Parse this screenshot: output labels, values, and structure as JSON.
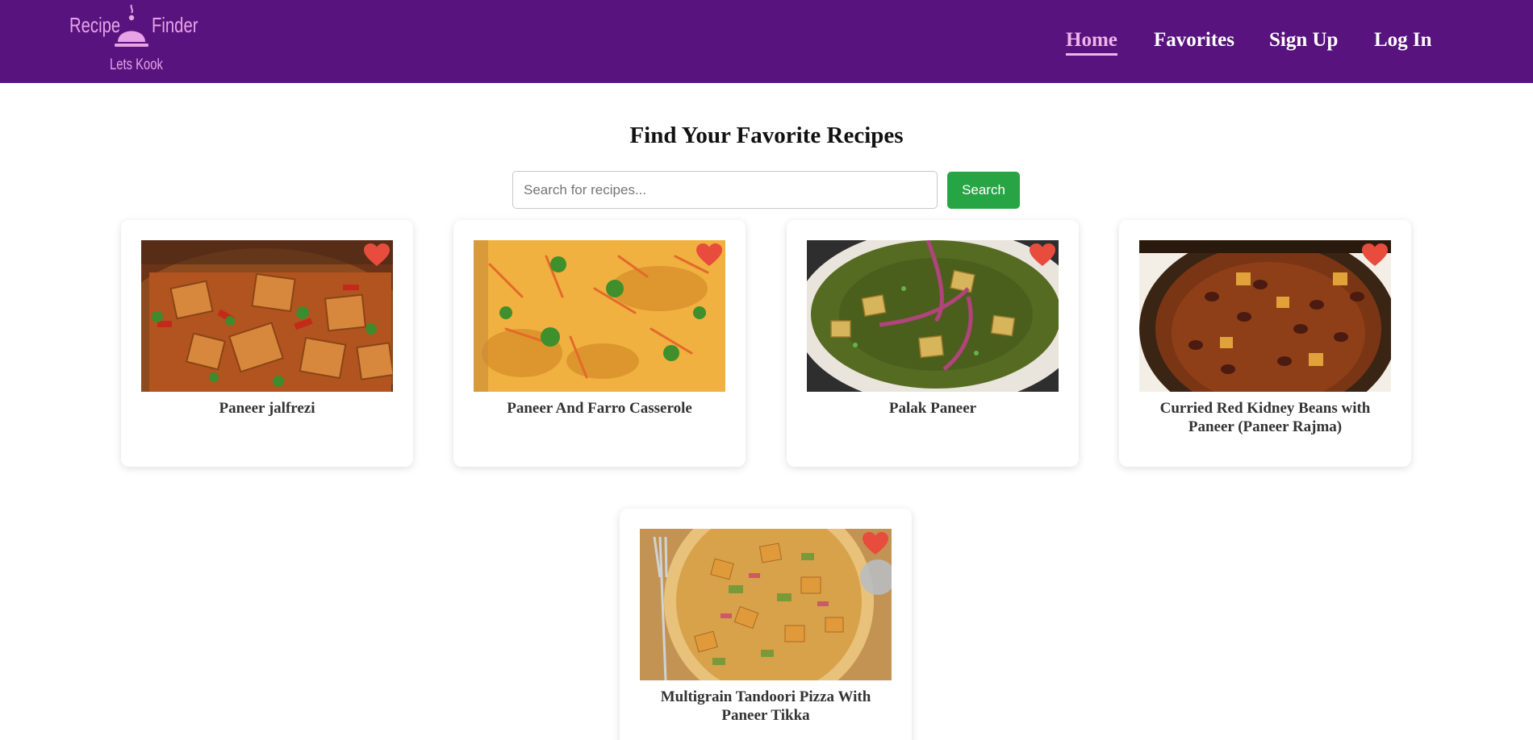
{
  "brand": {
    "left": "Recipe",
    "right": "Finder",
    "tagline": "Lets Kook"
  },
  "nav": {
    "home": "Home",
    "favorites": "Favorites",
    "signup": "Sign Up",
    "login": "Log In"
  },
  "main": {
    "title": "Find Your Favorite Recipes",
    "search": {
      "placeholder": "Search for recipes...",
      "button": "Search"
    }
  },
  "recipes": [
    {
      "title": "Paneer jalfrezi"
    },
    {
      "title": "Paneer And Farro Casserole"
    },
    {
      "title": "Palak Paneer"
    },
    {
      "title": "Curried Red Kidney Beans with Paneer (Paneer Rajma)"
    },
    {
      "title": "Multigrain Tandoori Pizza With Paneer Tikka"
    }
  ],
  "colors": {
    "navbar": "#58137e",
    "accent": "#f1b3ea",
    "search_button": "#27a545",
    "heart": "#e74c3c"
  }
}
